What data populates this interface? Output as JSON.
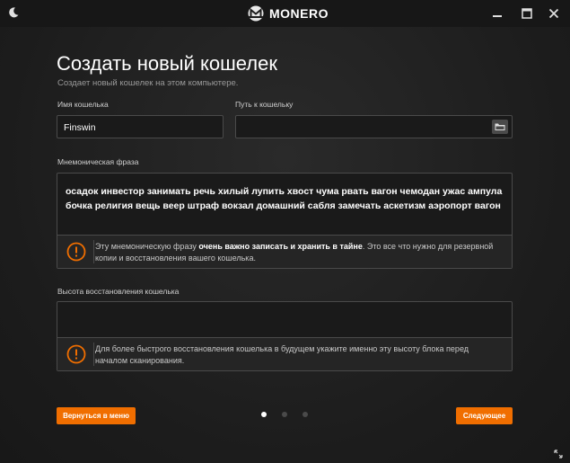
{
  "titlebar": {
    "brand": "MONERO",
    "icons": [
      "moon-icon",
      "monero-logo",
      "minimize-icon",
      "maximize-icon",
      "close-icon"
    ]
  },
  "page": {
    "title": "Создать новый кошелек",
    "subtitle": "Создает новый кошелек на этом компьютере."
  },
  "wallet_name": {
    "label": "Имя кошелька",
    "value": "Finswin"
  },
  "wallet_path": {
    "label": "Путь к кошельку",
    "value": ""
  },
  "seed": {
    "label": "Мнемоническая фраза",
    "text": "осадок инвестор занимать речь хилый лупить хвост чума рвать вагон чемодан ужас ампула бочка религия вещь веер штраф вокзал домашний сабля замечать аскетизм аэропорт вагон",
    "warning_pre": "Эту мнемоническую фразу ",
    "warning_bold": "очень важно записать и хранить в тайне",
    "warning_post": ". Это все что нужно для резервной копии и восстановления вашего кошелька."
  },
  "restore_height": {
    "label": "Высота восстановления кошелька",
    "value": "",
    "warning": "Для более быстрого восстановления кошелька в будущем укажите именно эту высоту блока перед началом сканирования."
  },
  "nav": {
    "back_label": "Вернуться в меню",
    "next_label": "Следующее",
    "steps": 3,
    "active_step": 1
  },
  "colors": {
    "accent": "#f06e00",
    "background": "#1d1d1d",
    "border": "#4a4a4a"
  }
}
